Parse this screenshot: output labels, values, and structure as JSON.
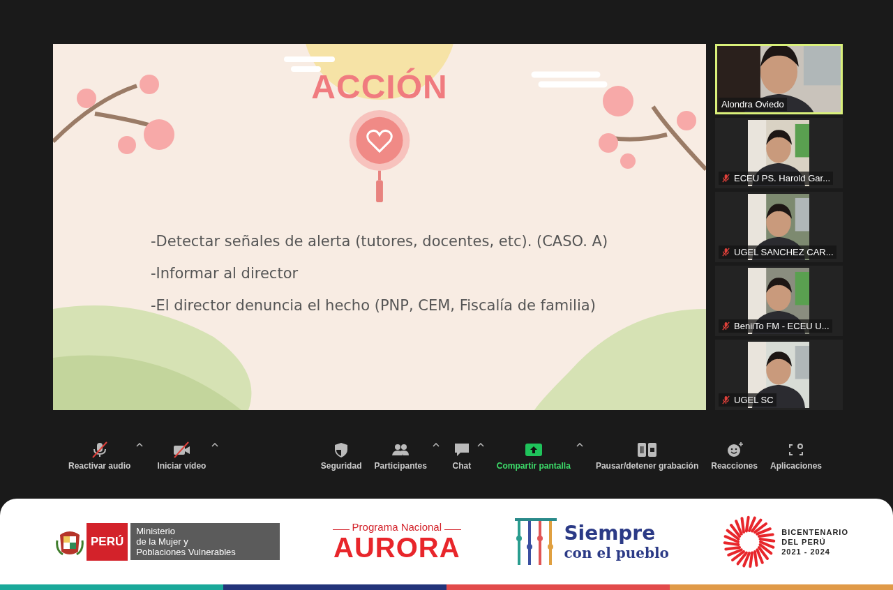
{
  "slide": {
    "title": "ACCIÓN",
    "bullets": [
      "-Detectar señales de alerta (tutores, docentes, etc). (CASO. A)",
      "-Informar al director",
      "-El director denuncia el hecho (PNP, CEM, Fiscalía de familia)"
    ]
  },
  "participants": [
    {
      "name": "Alondra Oviedo",
      "muted": false,
      "speaking": true
    },
    {
      "name": "ECEU PS. Harold Gar...",
      "muted": true,
      "speaking": false
    },
    {
      "name": "UGEL SANCHEZ CAR...",
      "muted": true,
      "speaking": false
    },
    {
      "name": "BeniiTo FM - ECEU U...",
      "muted": true,
      "speaking": false
    },
    {
      "name": "UGEL SC",
      "muted": true,
      "speaking": false
    }
  ],
  "toolbar": {
    "left": [
      {
        "kind": "mic",
        "label": "Reactivar audio",
        "off": true,
        "caret": true
      },
      {
        "kind": "video",
        "label": "Iniciar vídeo",
        "off": true,
        "caret": true
      }
    ],
    "center": [
      {
        "kind": "shield",
        "label": "Seguridad",
        "off": false,
        "caret": false
      },
      {
        "kind": "people",
        "label": "Participantes",
        "off": false,
        "caret": true
      },
      {
        "kind": "chat",
        "label": "Chat",
        "off": false,
        "caret": true
      },
      {
        "kind": "share",
        "label": "Compartir pantalla",
        "off": false,
        "caret": true
      },
      {
        "kind": "record",
        "label": "Pausar/detener grabación",
        "off": false,
        "caret": false
      },
      {
        "kind": "react",
        "label": "Reacciones",
        "off": false,
        "caret": false
      },
      {
        "kind": "apps",
        "label": "Aplicaciones",
        "off": false,
        "caret": false
      }
    ]
  },
  "footer": {
    "ministry": {
      "country": "PERÚ",
      "lines": [
        "Ministerio",
        "de la Mujer y",
        "Poblaciones Vulnerables"
      ]
    },
    "program": {
      "kicker": "Programa Nacional",
      "name": "AURORA"
    },
    "slogan": {
      "main": "Siempre",
      "sub": "con el pueblo"
    },
    "bicentennial": {
      "lines": [
        "BICENTENARIO",
        "DEL PERÚ",
        "2021 - 2024"
      ]
    }
  }
}
